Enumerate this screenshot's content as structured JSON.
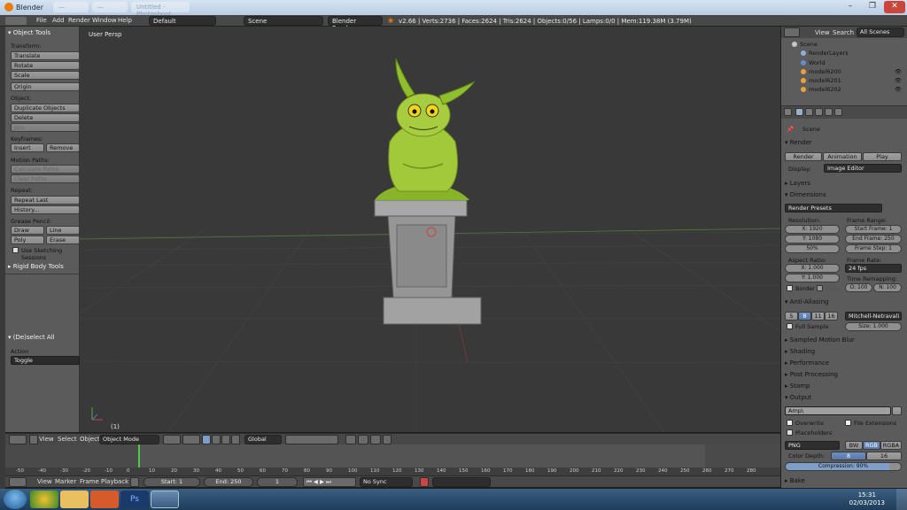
{
  "window": {
    "title": "Blender",
    "faded_tabs": [
      "—",
      "—",
      "Untitled - Photoshoot"
    ]
  },
  "topbar": {
    "menus": [
      "File",
      "Add",
      "Render",
      "Window",
      "Help"
    ],
    "layout": "Default",
    "scene": "Scene",
    "engine": "Blender Render",
    "stats": "v2.66 | Verts:2736 | Faces:2624 | Tris:2624 | Objects:0/56 | Lamps:0/0 | Mem:119.38M (3.79M)"
  },
  "toolshelf": {
    "title": "Object Tools",
    "transform_label": "Transform:",
    "translate": "Translate",
    "rotate": "Rotate",
    "scale": "Scale",
    "origin": "Origin",
    "object_label": "Object:",
    "duplicate": "Duplicate Objects",
    "delete": "Delete",
    "join": "Join",
    "keyframes_label": "Keyframes:",
    "insert": "Insert",
    "remove": "Remove",
    "motion_label": "Motion Paths:",
    "calc_paths": "Calculate Paths",
    "clear_paths": "Clear Paths",
    "repeat_label": "Repeat:",
    "repeat_last": "Repeat Last",
    "history": "History...",
    "grease_label": "Grease Pencil:",
    "draw": "Draw",
    "line": "Line",
    "poly": "Poly",
    "erase": "Erase",
    "sketching": "Use Sketching Sessions",
    "rigid": "Rigid Body Tools",
    "op_title": "(De)select All",
    "action_label": "Action",
    "action_value": "Toggle"
  },
  "viewport": {
    "label": "User Persp",
    "frame": "(1)"
  },
  "view_header": {
    "menus": [
      "View",
      "Select",
      "Object"
    ],
    "mode": "Object Mode",
    "orientation": "Global"
  },
  "timeline": {
    "ticks": [
      "-50",
      "-40",
      "-30",
      "-20",
      "-10",
      "0",
      "10",
      "20",
      "30",
      "40",
      "50",
      "60",
      "70",
      "80",
      "90",
      "100",
      "110",
      "120",
      "130",
      "140",
      "150",
      "160",
      "170",
      "180",
      "190",
      "200",
      "210",
      "220",
      "230",
      "240",
      "250",
      "260",
      "270",
      "280"
    ],
    "menus": [
      "View",
      "Marker",
      "Frame",
      "Playback"
    ],
    "start": "Start: 1",
    "end": "End: 250",
    "current": "1",
    "sync": "No Sync"
  },
  "outliner": {
    "menus": [
      "View",
      "Search"
    ],
    "filter": "All Scenes",
    "rows": [
      "Scene",
      "RenderLayers",
      "World",
      "model6200",
      "model6201",
      "model6202"
    ]
  },
  "properties": {
    "scene": "Scene",
    "render": "Render",
    "render_btn": "Render",
    "animation_btn": "Animation",
    "play_btn": "Play",
    "display_label": "Display:",
    "display_value": "Image Editor",
    "layers": "Layers",
    "dimensions": "Dimensions",
    "presets": "Render Presets",
    "resolution": "Resolution:",
    "res_x": "X: 1920",
    "res_y": "Y: 1080",
    "res_pct": "50%",
    "frame_range": "Frame Range:",
    "start_frame": "Start Frame: 1",
    "end_frame": "End Frame: 250",
    "frame_step": "Frame Step: 1",
    "aspect": "Aspect Ratio:",
    "asp_x": "X: 1.000",
    "asp_y": "Y: 1.000",
    "frame_rate": "Frame Rate:",
    "fps": "24 fps",
    "time_remap": "Time Remapping:",
    "remap_old": "O: 100",
    "remap_new": "N: 100",
    "border": "Border",
    "crop": "Crop",
    "aa": "Anti-Aliasing",
    "aa_samples": [
      "5",
      "8",
      "11",
      "16"
    ],
    "aa_filter": "Mitchell-Netravali",
    "full_sample": "Full Sample",
    "size": "Size: 1.000",
    "motion_blur": "Sampled Motion Blur",
    "shading": "Shading",
    "performance": "Performance",
    "post": "Post Processing",
    "stamp": "Stamp",
    "output": "Output",
    "output_path": "Amp\\",
    "overwrite": "Overwrite",
    "file_ext": "File Extensions",
    "placeholders": "Placeholders",
    "format": "PNG",
    "color_modes": [
      "BW",
      "RGB",
      "RGBA"
    ],
    "color_depth": "Color Depth:",
    "depths": [
      "8",
      "16"
    ],
    "compression": "Compression: 90%",
    "bake": "Bake"
  },
  "taskbar": {
    "time": "15:31",
    "date": "02/03/2013"
  },
  "colors": {
    "viewport_bg": "#393939",
    "panel_bg": "#5b5b5b",
    "header_bg": "#484848",
    "accent_blue": "#5878aa",
    "blender_orange": "#e87d0d"
  }
}
